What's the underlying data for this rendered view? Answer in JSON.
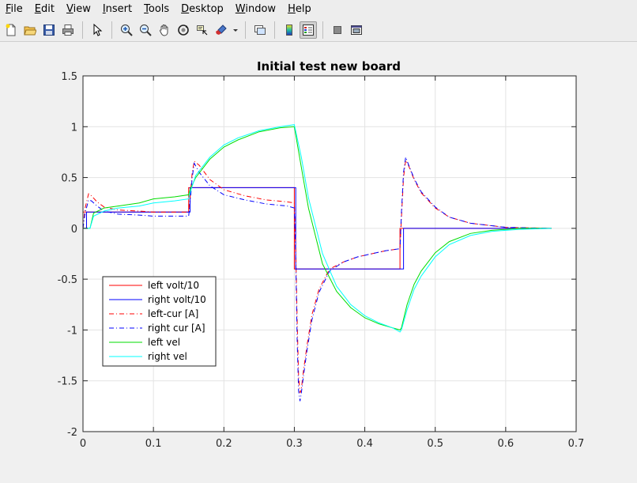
{
  "menu": {
    "items": [
      {
        "label": "File",
        "mnemonic": "F",
        "rest": "ile"
      },
      {
        "label": "Edit",
        "mnemonic": "E",
        "rest": "dit"
      },
      {
        "label": "View",
        "mnemonic": "V",
        "rest": "iew"
      },
      {
        "label": "Insert",
        "mnemonic": "I",
        "rest": "nsert"
      },
      {
        "label": "Tools",
        "mnemonic": "T",
        "rest": "ools"
      },
      {
        "label": "Desktop",
        "mnemonic": "D",
        "rest": "esktop"
      },
      {
        "label": "Window",
        "mnemonic": "W",
        "rest": "indow"
      },
      {
        "label": "Help",
        "mnemonic": "H",
        "rest": "elp"
      }
    ]
  },
  "toolbar": {
    "icons": [
      "new-figure-icon",
      "open-file-icon",
      "save-icon",
      "print-icon",
      "pointer-icon",
      "zoom-in-icon",
      "zoom-out-icon",
      "pan-hand-icon",
      "rotate-3d-icon",
      "data-cursor-icon",
      "brush-icon",
      "dropdown-arrow-icon",
      "link-plot-icon",
      "colorbar-icon",
      "legend-icon",
      "hide-plot-tools-icon",
      "show-plot-tools-icon"
    ]
  },
  "chart_data": {
    "type": "line",
    "title": "Initial test new board",
    "xlabel": "",
    "ylabel": "",
    "xlim": [
      0,
      0.7
    ],
    "ylim": [
      -2,
      1.5
    ],
    "xticks": [
      0,
      0.1,
      0.2,
      0.3,
      0.4,
      0.5,
      0.6,
      0.7
    ],
    "xtick_labels": [
      "0",
      "0.1",
      "0.2",
      "0.3",
      "0.4",
      "0.5",
      "0.6",
      "0.7"
    ],
    "yticks": [
      -2,
      -1.5,
      -1,
      -0.5,
      0,
      0.5,
      1,
      1.5
    ],
    "ytick_labels": [
      "-2",
      "-1.5",
      "-1",
      "-0.5",
      "0",
      "0.5",
      "1",
      "1.5"
    ],
    "grid": true,
    "legend_position": "lower-left",
    "series": [
      {
        "name": "left volt/10",
        "color": "#ff0000",
        "style": "solid",
        "x": [
          0,
          0.005,
          0.005,
          0.15,
          0.15,
          0.15,
          0.15,
          0.3,
          0.3,
          0.3,
          0.3,
          0.45,
          0.45,
          0.45,
          0.45,
          0.665
        ],
        "y": [
          0.16,
          0.16,
          0.16,
          0.16,
          0.16,
          0.16,
          0.4,
          0.4,
          0.4,
          0.4,
          -0.4,
          -0.4,
          -0.4,
          -0.4,
          0,
          0
        ]
      },
      {
        "name": "right volt/10",
        "color": "#0000ff",
        "style": "solid",
        "x": [
          0,
          0.005,
          0.005,
          0.152,
          0.152,
          0.152,
          0.152,
          0.302,
          0.302,
          0.302,
          0.302,
          0.455,
          0.455,
          0.455,
          0.455,
          0.665
        ],
        "y": [
          0,
          0,
          0.16,
          0.16,
          0.16,
          0.16,
          0.4,
          0.4,
          0.4,
          0.4,
          -0.4,
          -0.4,
          -0.4,
          -0.4,
          0,
          0
        ]
      },
      {
        "name": "left-cur  [A]",
        "color": "#ff0000",
        "style": "dashdot",
        "x": [
          0,
          0.003,
          0.008,
          0.012,
          0.02,
          0.03,
          0.05,
          0.08,
          0.1,
          0.13,
          0.15,
          0.152,
          0.155,
          0.158,
          0.165,
          0.18,
          0.2,
          0.23,
          0.26,
          0.29,
          0.3,
          0.302,
          0.304,
          0.306,
          0.308,
          0.31,
          0.313,
          0.318,
          0.325,
          0.335,
          0.35,
          0.37,
          0.39,
          0.41,
          0.43,
          0.45,
          0.452,
          0.455,
          0.458,
          0.462,
          0.47,
          0.48,
          0.5,
          0.52,
          0.55,
          0.6,
          0.665
        ],
        "y": [
          0,
          0.2,
          0.34,
          0.32,
          0.26,
          0.21,
          0.18,
          0.17,
          0.16,
          0.16,
          0.16,
          0.3,
          0.55,
          0.66,
          0.62,
          0.48,
          0.38,
          0.32,
          0.28,
          0.26,
          0.25,
          -0.2,
          -0.9,
          -1.45,
          -1.62,
          -1.58,
          -1.4,
          -1.15,
          -0.85,
          -0.6,
          -0.4,
          -0.33,
          -0.28,
          -0.25,
          -0.22,
          -0.2,
          0.1,
          0.5,
          0.67,
          0.62,
          0.48,
          0.35,
          0.2,
          0.11,
          0.05,
          0.01,
          0
        ]
      },
      {
        "name": "right cur [A]",
        "color": "#0000ff",
        "style": "dashdot",
        "x": [
          0,
          0.003,
          0.008,
          0.012,
          0.02,
          0.03,
          0.05,
          0.08,
          0.1,
          0.13,
          0.15,
          0.152,
          0.155,
          0.158,
          0.165,
          0.18,
          0.2,
          0.23,
          0.26,
          0.29,
          0.3,
          0.302,
          0.304,
          0.306,
          0.308,
          0.31,
          0.313,
          0.318,
          0.325,
          0.335,
          0.35,
          0.37,
          0.39,
          0.41,
          0.43,
          0.45,
          0.452,
          0.455,
          0.458,
          0.462,
          0.47,
          0.48,
          0.5,
          0.52,
          0.55,
          0.6,
          0.665
        ],
        "y": [
          0,
          0.15,
          0.28,
          0.27,
          0.22,
          0.17,
          0.14,
          0.13,
          0.12,
          0.12,
          0.12,
          0.25,
          0.5,
          0.64,
          0.55,
          0.42,
          0.33,
          0.28,
          0.24,
          0.22,
          0.2,
          -0.3,
          -1.1,
          -1.6,
          -1.7,
          -1.62,
          -1.45,
          -1.2,
          -0.9,
          -0.63,
          -0.42,
          -0.33,
          -0.28,
          -0.25,
          -0.22,
          -0.2,
          0.15,
          0.55,
          0.7,
          0.63,
          0.49,
          0.36,
          0.21,
          0.11,
          0.05,
          0.01,
          0
        ]
      },
      {
        "name": "left vel",
        "color": "#00dd00",
        "style": "solid",
        "x": [
          0,
          0.01,
          0.015,
          0.03,
          0.05,
          0.08,
          0.1,
          0.13,
          0.15,
          0.152,
          0.16,
          0.18,
          0.2,
          0.22,
          0.25,
          0.28,
          0.3,
          0.31,
          0.32,
          0.34,
          0.36,
          0.38,
          0.4,
          0.42,
          0.44,
          0.45,
          0.452,
          0.46,
          0.47,
          0.48,
          0.5,
          0.52,
          0.55,
          0.58,
          0.62,
          0.665
        ],
        "y": [
          0,
          0,
          0.15,
          0.2,
          0.22,
          0.25,
          0.29,
          0.31,
          0.33,
          0.38,
          0.5,
          0.68,
          0.8,
          0.87,
          0.95,
          0.99,
          1.0,
          0.6,
          0.2,
          -0.35,
          -0.62,
          -0.78,
          -0.88,
          -0.94,
          -0.98,
          -1.0,
          -0.98,
          -0.75,
          -0.55,
          -0.42,
          -0.24,
          -0.13,
          -0.05,
          -0.02,
          0,
          0
        ]
      },
      {
        "name": "right vel",
        "color": "#00ffff",
        "style": "solid",
        "x": [
          0,
          0.01,
          0.015,
          0.03,
          0.05,
          0.08,
          0.1,
          0.13,
          0.15,
          0.152,
          0.16,
          0.18,
          0.2,
          0.22,
          0.25,
          0.28,
          0.3,
          0.31,
          0.32,
          0.34,
          0.36,
          0.38,
          0.4,
          0.42,
          0.44,
          0.45,
          0.452,
          0.46,
          0.47,
          0.48,
          0.5,
          0.52,
          0.55,
          0.58,
          0.62,
          0.665
        ],
        "y": [
          0,
          0,
          0.12,
          0.17,
          0.2,
          0.22,
          0.25,
          0.27,
          0.29,
          0.35,
          0.52,
          0.7,
          0.82,
          0.89,
          0.96,
          1.0,
          1.02,
          0.7,
          0.3,
          -0.25,
          -0.57,
          -0.75,
          -0.86,
          -0.93,
          -0.98,
          -1.02,
          -1.0,
          -0.8,
          -0.6,
          -0.47,
          -0.28,
          -0.16,
          -0.07,
          -0.03,
          -0.01,
          0
        ]
      }
    ]
  }
}
